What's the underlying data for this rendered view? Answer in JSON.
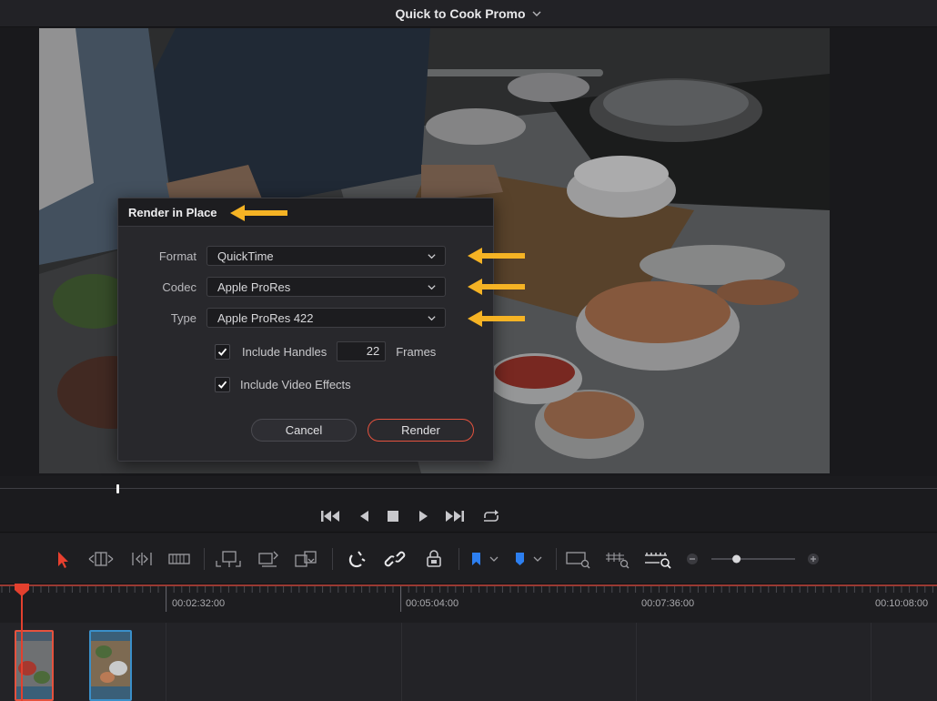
{
  "titlebar": {
    "title": "Quick to Cook Promo"
  },
  "dialog": {
    "title": "Render in Place",
    "format": {
      "label": "Format",
      "value": "QuickTime"
    },
    "codec": {
      "label": "Codec",
      "value": "Apple ProRes"
    },
    "type": {
      "label": "Type",
      "value": "Apple ProRes 422"
    },
    "include_handles": {
      "label": "Include Handles",
      "checked": true,
      "frames_value": "22",
      "frames_label": "Frames"
    },
    "include_video_effects": {
      "label": "Include Video Effects",
      "checked": true
    },
    "cancel_label": "Cancel",
    "render_label": "Render"
  },
  "annotation_color": "#f5b324",
  "accent_color": "#e5523e",
  "ruler": {
    "timecodes": [
      "00:02:32:00",
      "00:05:04:00",
      "00:07:36:00",
      "00:10:08:00"
    ]
  },
  "toolbar": {
    "icons": [
      "selection-arrow-icon",
      "trim-edit-icon",
      "dynamic-trim-icon",
      "blade-icon",
      "insert-clip-icon",
      "overwrite-clip-icon",
      "replace-clip-icon",
      "snapping-icon",
      "linked-selection-icon",
      "position-lock-icon",
      "flag-icon",
      "marker-icon",
      "full-extent-zoom-icon",
      "detail-zoom-icon",
      "custom-zoom-icon",
      "zoom-out-icon",
      "zoom-slider",
      "zoom-in-icon"
    ],
    "zoom_level": 0.3
  },
  "transport": {
    "icons": [
      "go-to-start-icon",
      "play-reverse-icon",
      "stop-icon",
      "play-icon",
      "go-to-end-icon",
      "loop-icon"
    ]
  }
}
